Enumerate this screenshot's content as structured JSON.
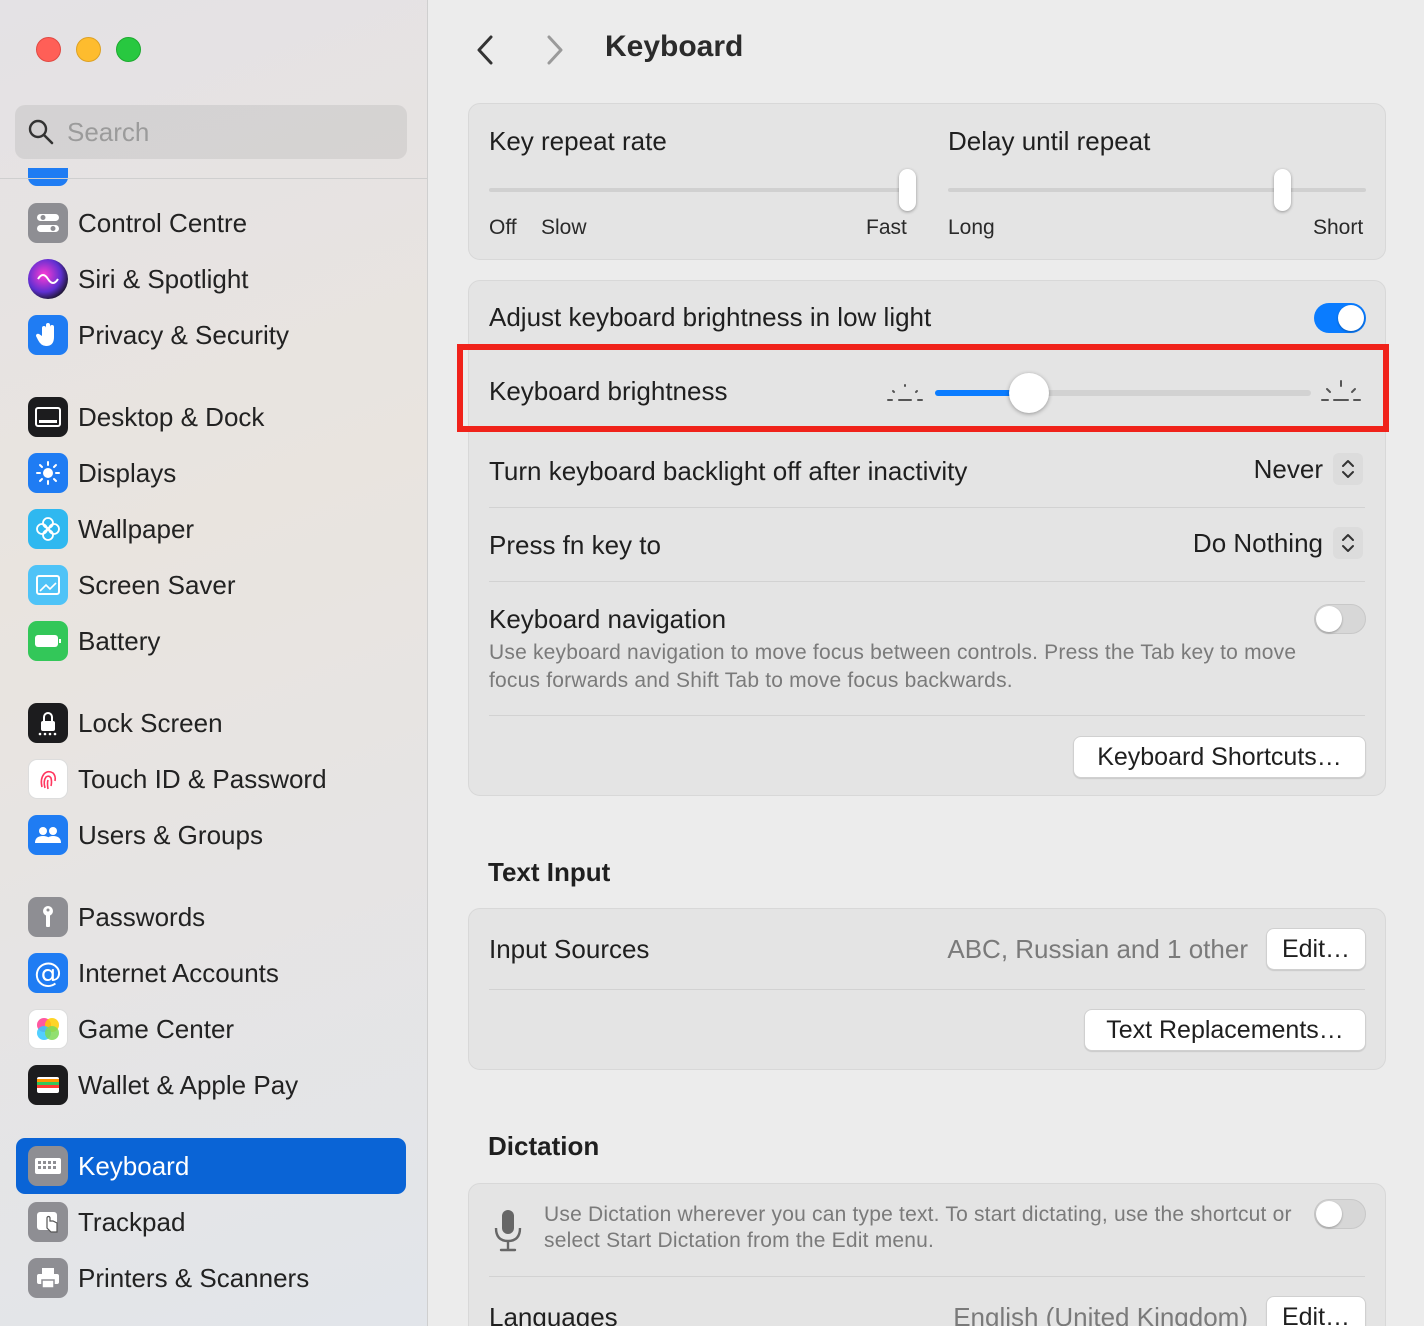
{
  "window": {
    "title": "Keyboard"
  },
  "search": {
    "placeholder": "Search"
  },
  "sidebar": {
    "items": [
      {
        "label": "Control Centre",
        "icon": "control-centre-icon",
        "color": "#8e8e93"
      },
      {
        "label": "Siri & Spotlight",
        "icon": "siri-icon",
        "color": "#5e2fd1"
      },
      {
        "label": "Privacy & Security",
        "icon": "hand-icon",
        "color": "#1f7cf3"
      },
      {
        "label": "Desktop & Dock",
        "icon": "dock-icon",
        "color": "#1c1c1e"
      },
      {
        "label": "Displays",
        "icon": "sun-icon",
        "color": "#1f7cf3"
      },
      {
        "label": "Wallpaper",
        "icon": "flower-icon",
        "color": "#2fb8f0"
      },
      {
        "label": "Screen Saver",
        "icon": "screen-saver-icon",
        "color": "#4fc3f7"
      },
      {
        "label": "Battery",
        "icon": "battery-icon",
        "color": "#33c759"
      },
      {
        "label": "Lock Screen",
        "icon": "lock-icon",
        "color": "#1c1c1e"
      },
      {
        "label": "Touch ID & Password",
        "icon": "fingerprint-icon",
        "color": "#ffffff"
      },
      {
        "label": "Users & Groups",
        "icon": "users-icon",
        "color": "#1f7cf3"
      },
      {
        "label": "Passwords",
        "icon": "key-icon",
        "color": "#8e8e93"
      },
      {
        "label": "Internet Accounts",
        "icon": "at-icon",
        "color": "#1f7cf3"
      },
      {
        "label": "Game Center",
        "icon": "game-center-icon",
        "color": "#ffffff"
      },
      {
        "label": "Wallet & Apple Pay",
        "icon": "wallet-icon",
        "color": "#1c1c1e"
      },
      {
        "label": "Keyboard",
        "icon": "keyboard-icon",
        "color": "#8e8e93",
        "active": true
      },
      {
        "label": "Trackpad",
        "icon": "trackpad-icon",
        "color": "#8e8e93"
      },
      {
        "label": "Printers & Scanners",
        "icon": "printer-icon",
        "color": "#8e8e93"
      }
    ]
  },
  "key_repeat": {
    "label": "Key repeat rate",
    "min_label": "Off",
    "slow_label": "Slow",
    "max_label": "Fast",
    "value_step": 7,
    "steps": 8
  },
  "delay_repeat": {
    "label": "Delay until repeat",
    "min_label": "Long",
    "max_label": "Short",
    "value_step": 4,
    "steps": 6
  },
  "adjust_brightness": {
    "label": "Adjust keyboard brightness in low light",
    "on": true
  },
  "keyboard_brightness": {
    "label": "Keyboard brightness",
    "value_fraction": 0.25
  },
  "backlight_off": {
    "label": "Turn keyboard backlight off after inactivity",
    "value": "Never"
  },
  "fn_key": {
    "label": "Press fn key to",
    "value": "Do Nothing"
  },
  "keyboard_navigation": {
    "label": "Keyboard navigation",
    "description": "Use keyboard navigation to move focus between controls. Press the Tab key to move focus forwards and Shift Tab to move focus backwards.",
    "on": false
  },
  "keyboard_shortcuts_button": "Keyboard Shortcuts…",
  "text_input": {
    "title": "Text Input",
    "input_sources_label": "Input Sources",
    "input_sources_value": "ABC, Russian and 1 other",
    "edit_button": "Edit…",
    "text_replacements_button": "Text Replacements…"
  },
  "dictation": {
    "title": "Dictation",
    "description": "Use Dictation wherever you can type text. To start dictating, use the shortcut or select Start Dictation from the Edit menu.",
    "on": false,
    "languages_label": "Languages",
    "languages_value": "English (United Kingdom)",
    "edit_button": "Edit…"
  },
  "colors": {
    "accent": "#0a7cff",
    "sidebar_active": "#0a64d6",
    "highlight": "#f0221a"
  }
}
